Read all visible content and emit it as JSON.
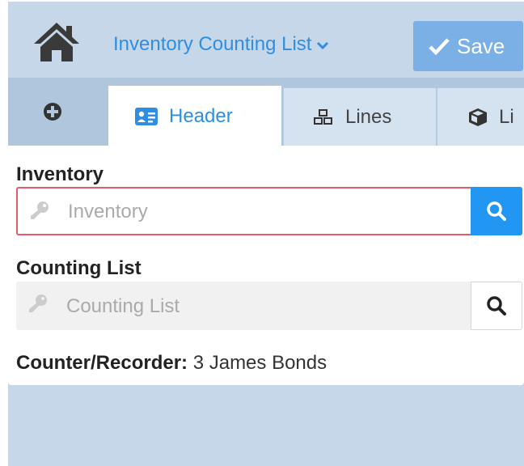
{
  "header": {
    "title": "Inventory Counting List",
    "save_label": "Save",
    "home_icon": "home-icon",
    "chevron_icon": "chevron-down-icon"
  },
  "tabs": [
    {
      "icon": "plus-circle-icon",
      "label": ""
    },
    {
      "icon": "id-card-icon",
      "label": "Header",
      "active": true
    },
    {
      "icon": "cubes-icon",
      "label": "Lines"
    },
    {
      "icon": "cube-icon",
      "label": "Li"
    }
  ],
  "form": {
    "inventory": {
      "label": "Inventory",
      "placeholder": "Inventory",
      "value": ""
    },
    "counting_list": {
      "label": "Counting List",
      "placeholder": "Counting List",
      "value": ""
    },
    "counter": {
      "label": "Counter/Recorder:",
      "value": "3 James Bonds"
    }
  },
  "colors": {
    "accent": "#2f8ee0",
    "primary_button": "#2196f3",
    "save_button": "#7ab0e6",
    "error_border": "#e35b6d",
    "header_bg": "#c5d7e8"
  }
}
